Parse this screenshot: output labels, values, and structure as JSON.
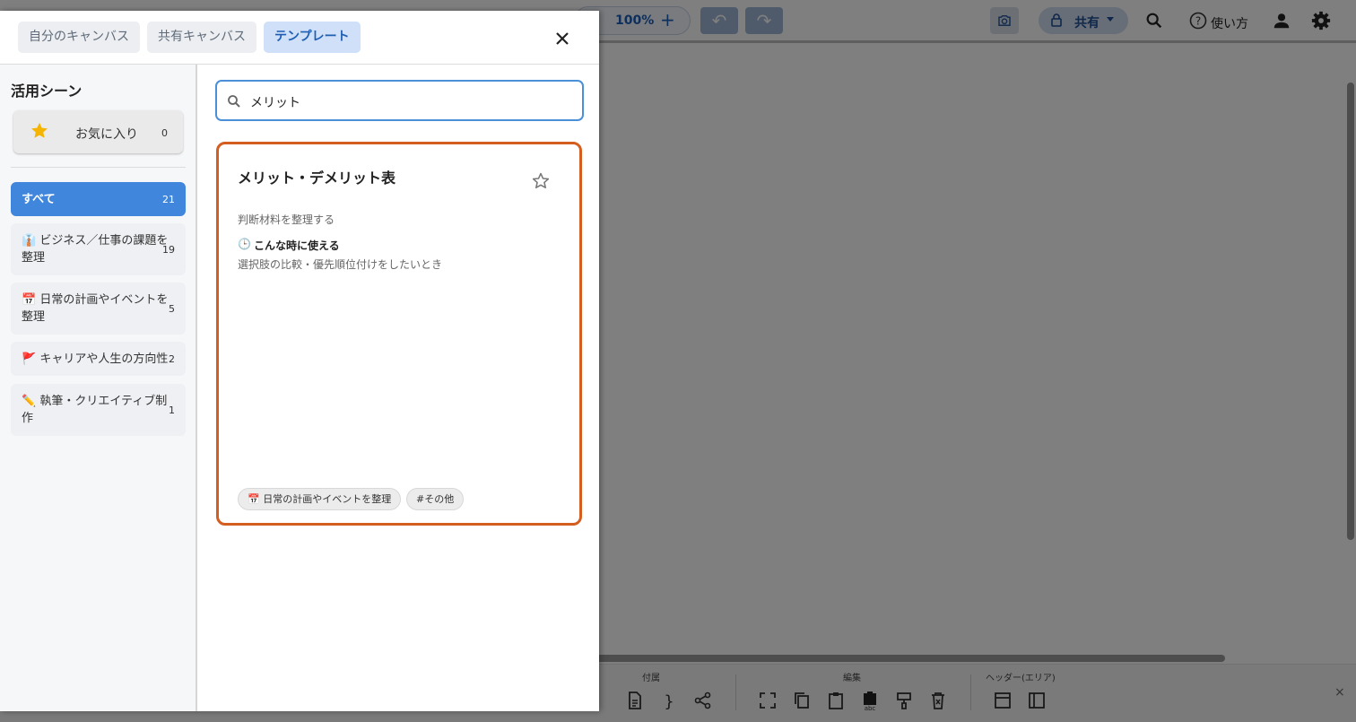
{
  "toolbar": {
    "zoom": "100%",
    "zoom_in": "+",
    "undo": "↶",
    "redo": "↷",
    "share_label": "共有",
    "help_label": "使い方"
  },
  "bottom_toolbar": {
    "groups": [
      "付属",
      "編集",
      "ヘッダー(エリア)"
    ],
    "close": "×"
  },
  "modal": {
    "tabs": [
      "自分のキャンバス",
      "共有キャンバス",
      "テンプレート"
    ],
    "active_tab": "テンプレート"
  },
  "sidebar": {
    "title": "活用シーン",
    "favorites": {
      "label": "お気に入り",
      "count": "0"
    },
    "categories": [
      {
        "label": "すべて",
        "count": "21",
        "active": true
      },
      {
        "label": "👔 ビジネス／仕事の課題を整理",
        "count": "19"
      },
      {
        "label": "📅 日常の計画やイベントを整理",
        "count": "5"
      },
      {
        "label": "🚩 キャリアや人生の方向性",
        "count": "2"
      },
      {
        "label": "✏️ 執筆・クリエイティブ制作",
        "count": "1"
      }
    ]
  },
  "search": {
    "value": "メリット"
  },
  "results": [
    {
      "title": "メリット・デメリット表",
      "subtitle": "判断材料を整理する",
      "when_label": "こんな時に使える",
      "when_icon": "🕒",
      "when_text": "選択肢の比較・優先順位付けをしたいとき",
      "category_chip": "📅 日常の計画やイベントを整理",
      "tag_chip": "#その他"
    }
  ],
  "colors": {
    "accent": "#3f86dc",
    "card_border": "#d45e1f",
    "tab_active_bg": "#cfe0f8",
    "search_border": "#4a90d9"
  }
}
